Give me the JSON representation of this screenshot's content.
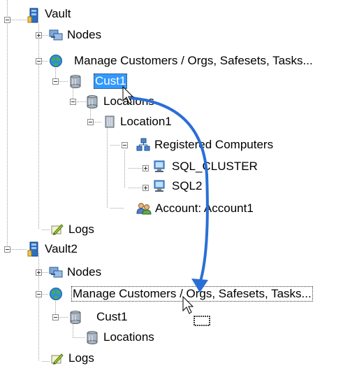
{
  "tree": {
    "vault": {
      "label": "Vault",
      "nodes_label": "Nodes",
      "manage_label": "Manage Customers / Orgs, Safesets, Tasks...",
      "customer_label": "Cust1",
      "locations_label": "Locations",
      "location1_label": "Location1",
      "registered_label": "Registered Computers",
      "computers": [
        "SQL_CLUSTER",
        "SQL2"
      ],
      "account_label": "Account: Account1",
      "logs_label": "Logs"
    },
    "vault2": {
      "label": "Vault2",
      "nodes_label": "Nodes",
      "manage_label": "Manage Customers / Orgs, Safesets, Tasks...",
      "customer_label": "Cust1",
      "locations_label": "Locations",
      "logs_label": "Logs"
    }
  },
  "colors": {
    "selection": "#3399ff",
    "drag_arrow": "#2a6fd6",
    "tree_line": "#a0a0a0"
  },
  "icons": [
    "vault-icon",
    "nodes-icon",
    "globe-icon",
    "database-icon",
    "location-icon",
    "network-icon",
    "computer-icon",
    "account-icon",
    "logs-icon"
  ]
}
